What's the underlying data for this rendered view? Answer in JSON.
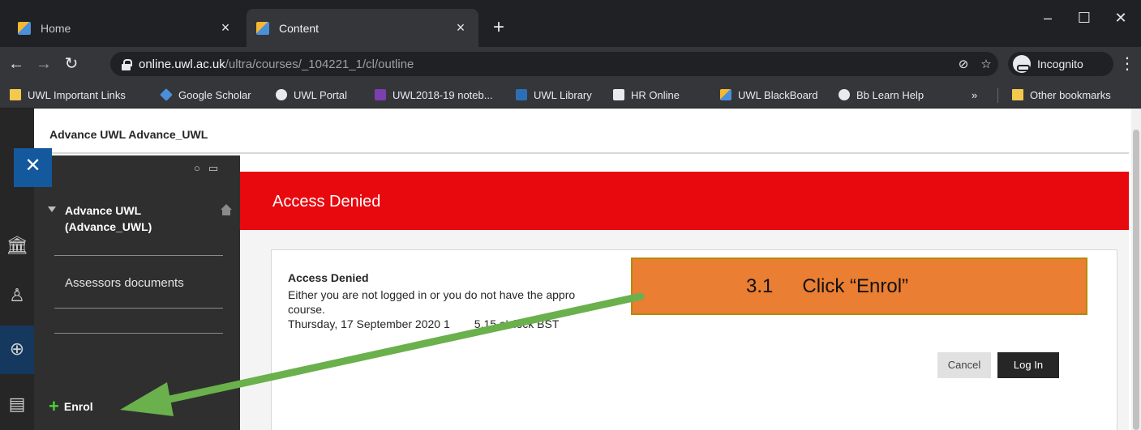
{
  "browser": {
    "tabs": [
      {
        "title": "Home",
        "active": false
      },
      {
        "title": "Content",
        "active": true
      }
    ],
    "new_tab_label": "+",
    "address": {
      "host": "online.uwl.ac.uk",
      "path": "/ultra/courses/_104221_1/cl/outline"
    },
    "incognito_label": "Incognito",
    "bookmarks": [
      {
        "label": "UWL Important Links",
        "icon": "folder-icon"
      },
      {
        "label": "Google Scholar",
        "icon": "google-scholar-icon"
      },
      {
        "label": "UWL Portal",
        "icon": "globe-icon"
      },
      {
        "label": "UWL2018-19 noteb...",
        "icon": "onenote-icon"
      },
      {
        "label": "UWL Library",
        "icon": "library-icon"
      },
      {
        "label": "HR Online",
        "icon": "hr-icon"
      },
      {
        "label": "UWL BlackBoard",
        "icon": "blackboard-icon"
      },
      {
        "label": "Bb Learn Help",
        "icon": "globe-icon"
      }
    ],
    "bookmarks_overflow": "»",
    "other_bookmarks": "Other bookmarks"
  },
  "page": {
    "course_header_title": "Advance UWL Advance_UWL",
    "course_menu": {
      "course_name": "Advance UWL (Advance_UWL)",
      "items": [
        "Assessors documents"
      ],
      "enrol_label": "Enrol"
    },
    "banner_title": "Access Denied",
    "message": {
      "title": "Access Denied",
      "line1": "Either you are not logged in or you do not have the appro",
      "line2": "course.",
      "line3": "Thursday, 17 September 2020 1",
      "line3_tail": "5.15 o'clock BST"
    },
    "buttons": {
      "cancel": "Cancel",
      "login": "Log In"
    }
  },
  "annotation": {
    "step": "3.1",
    "text": "Click “Enrol”",
    "box_color": "#ea7e33",
    "arrow_color": "#6ab04c"
  }
}
